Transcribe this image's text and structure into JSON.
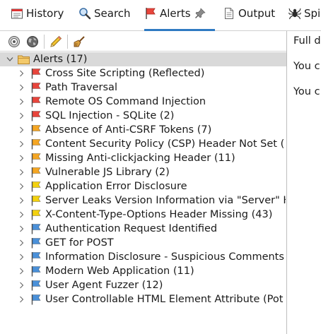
{
  "tabs": [
    {
      "label": "History",
      "icon": "history-icon",
      "active": false
    },
    {
      "label": "Search",
      "icon": "search-icon",
      "active": false
    },
    {
      "label": "Alerts",
      "icon": "flag-icon",
      "active": true,
      "pin_icon": "pin-icon"
    },
    {
      "label": "Output",
      "icon": "document-icon",
      "active": false
    },
    {
      "label": "Spi",
      "icon": "spider-icon",
      "active": false
    }
  ],
  "toolbar": {
    "buttons": [
      {
        "icon": "scope-filter-icon"
      },
      {
        "icon": "globe-icon"
      },
      {
        "icon": "pencil-icon"
      },
      {
        "icon": "broom-icon"
      }
    ]
  },
  "tree": {
    "root": {
      "label": "Alerts (17)",
      "icon": "folder-icon",
      "expanded": true
    },
    "items": [
      {
        "label": "Cross Site Scripting (Reflected)",
        "risk": "high"
      },
      {
        "label": "Path Traversal",
        "risk": "high"
      },
      {
        "label": "Remote OS Command Injection",
        "risk": "high"
      },
      {
        "label": "SQL Injection - SQLite (2)",
        "risk": "high"
      },
      {
        "label": "Absence of Anti-CSRF Tokens (7)",
        "risk": "medium"
      },
      {
        "label": "Content Security Policy (CSP) Header Not Set (",
        "risk": "medium"
      },
      {
        "label": "Missing Anti-clickjacking Header (11)",
        "risk": "medium"
      },
      {
        "label": "Vulnerable JS Library (2)",
        "risk": "medium"
      },
      {
        "label": "Application Error Disclosure",
        "risk": "low"
      },
      {
        "label": "Server Leaks Version Information via \"Server\" H",
        "risk": "low"
      },
      {
        "label": "X-Content-Type-Options Header Missing (43)",
        "risk": "low"
      },
      {
        "label": "Authentication Request Identified",
        "risk": "informational"
      },
      {
        "label": "GET for POST",
        "risk": "informational"
      },
      {
        "label": "Information Disclosure - Suspicious Comments",
        "risk": "informational"
      },
      {
        "label": "Modern Web Application (11)",
        "risk": "informational"
      },
      {
        "label": "User Agent Fuzzer (12)",
        "risk": "informational"
      },
      {
        "label": "User Controllable HTML Element Attribute (Pot",
        "risk": "informational"
      }
    ]
  },
  "risk_colors": {
    "high": "#e8453c",
    "medium": "#f5a623",
    "low": "#f3d10f",
    "informational": "#4a90d9"
  },
  "right_panel": {
    "lines": [
      "Full d",
      "You c",
      "You c"
    ]
  },
  "colors": {
    "accent": "#2f7ac2",
    "root_row_bg": "#d9d9d9"
  }
}
